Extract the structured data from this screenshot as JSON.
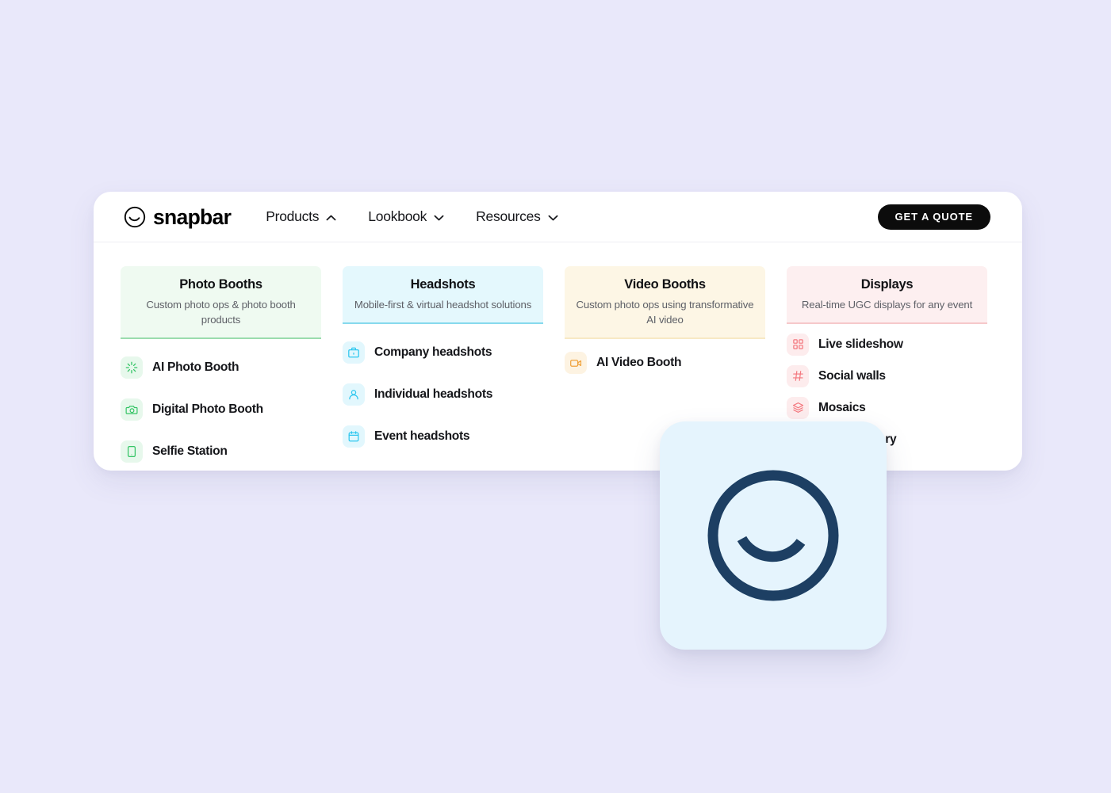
{
  "page": {
    "background_color": "#e9e8fa"
  },
  "nav": {
    "logo_text": "snapbar",
    "logo_icon": "snapbar-smile-circle-icon",
    "links": [
      {
        "label": "Products",
        "chevron": "chevron-up-icon",
        "expanded": true
      },
      {
        "label": "Lookbook",
        "chevron": "chevron-down-icon",
        "expanded": false
      },
      {
        "label": "Resources",
        "chevron": "chevron-down-icon",
        "expanded": false
      }
    ],
    "cta": {
      "label": "GET A QUOTE",
      "bg_color": "#0c0c0c",
      "text_color": "#ffffff"
    }
  },
  "mega_menu": {
    "columns": [
      {
        "key": "photo-booths",
        "title": "Photo Booths",
        "description": "Custom photo ops & photo booth products",
        "accent_color": "#34c465",
        "head_bg": "#effaf1",
        "items": [
          {
            "label": "AI Photo Booth",
            "icon": "sparkle-icon"
          },
          {
            "label": "Digital Photo Booth",
            "icon": "camera-icon"
          },
          {
            "label": "Selfie Station",
            "icon": "tablet-icon"
          }
        ]
      },
      {
        "key": "headshots",
        "title": "Headshots",
        "description": "Mobile-first & virtual headshot solutions",
        "accent_color": "#2ec7ef",
        "head_bg": "#e4f8fd",
        "items": [
          {
            "label": "Company headshots",
            "icon": "briefcase-icon"
          },
          {
            "label": "Individual headshots",
            "icon": "person-icon"
          },
          {
            "label": "Event headshots",
            "icon": "calendar-icon"
          }
        ]
      },
      {
        "key": "video-booths",
        "title": "Video Booths",
        "description": "Custom photo ops using transformative AI video",
        "accent_color": "#f8e9c4",
        "head_bg": "#fdf6e5",
        "items": [
          {
            "label": "AI Video Booth",
            "icon": "video-camera-icon"
          }
        ]
      },
      {
        "key": "displays",
        "title": "Displays",
        "description": "Real-time UGC displays for any event",
        "accent_color": "#f6c8ca",
        "head_bg": "#fdeff0",
        "items": [
          {
            "label": "Live slideshow",
            "icon": "grid-icon"
          },
          {
            "label": "Social walls",
            "icon": "hashtag-icon"
          },
          {
            "label": "Mosaics",
            "icon": "layers-icon"
          },
          {
            "label": "Booth Gallery",
            "icon": "gallery-icon"
          }
        ]
      }
    ]
  },
  "floating_card": {
    "icon": "snapbar-smile-circle-icon",
    "bg_color": "#e5f4fd",
    "icon_color": "#1d3f63"
  }
}
